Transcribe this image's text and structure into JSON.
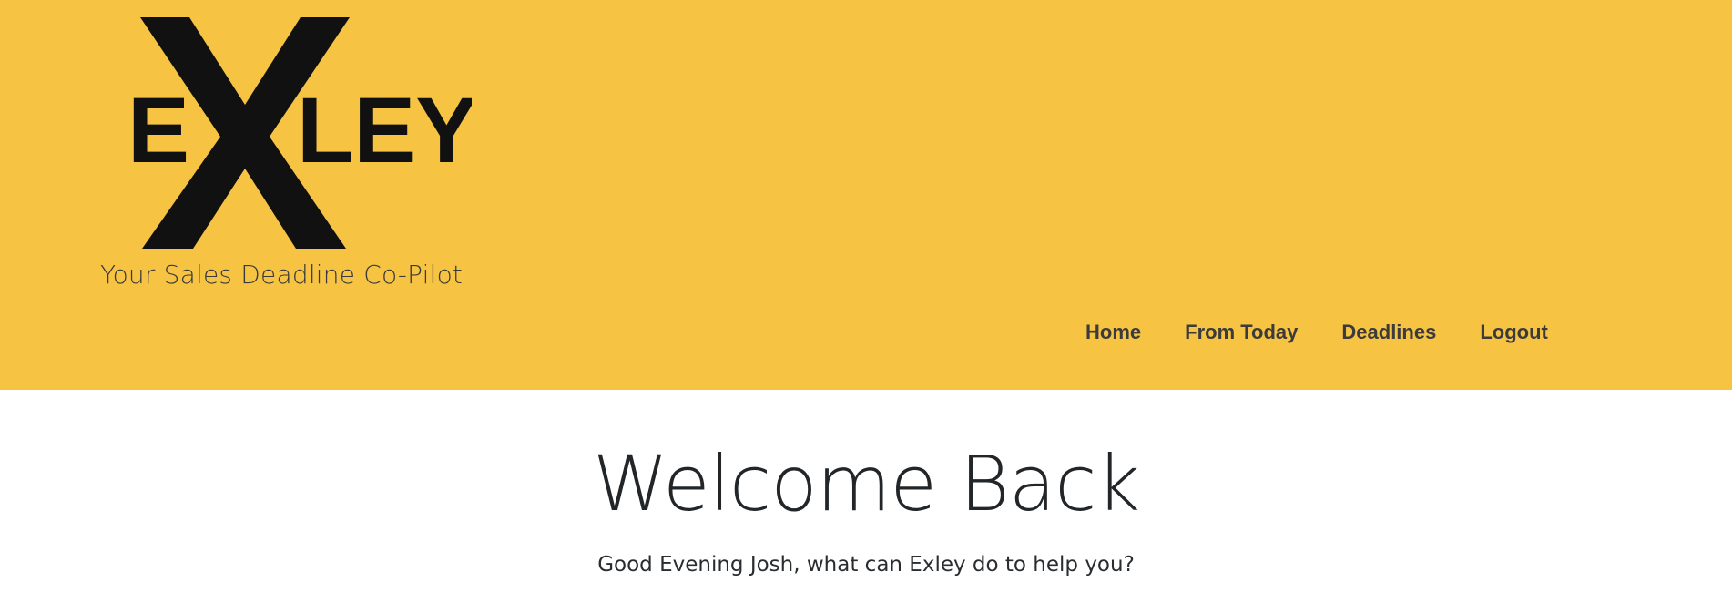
{
  "header": {
    "background_color": "#f6c343",
    "logo": {
      "text": "EXLEY",
      "letters_left": "E",
      "letter_big": "X",
      "letters_right": "LEY"
    },
    "tagline": "Your Sales Deadline Co-Pilot"
  },
  "nav": {
    "items": [
      {
        "label": "Home"
      },
      {
        "label": "From Today"
      },
      {
        "label": "Deadlines"
      },
      {
        "label": "Logout"
      }
    ]
  },
  "main": {
    "title": "Welcome Back",
    "greeting": "Good Evening Josh, what can Exley do to help you?"
  }
}
